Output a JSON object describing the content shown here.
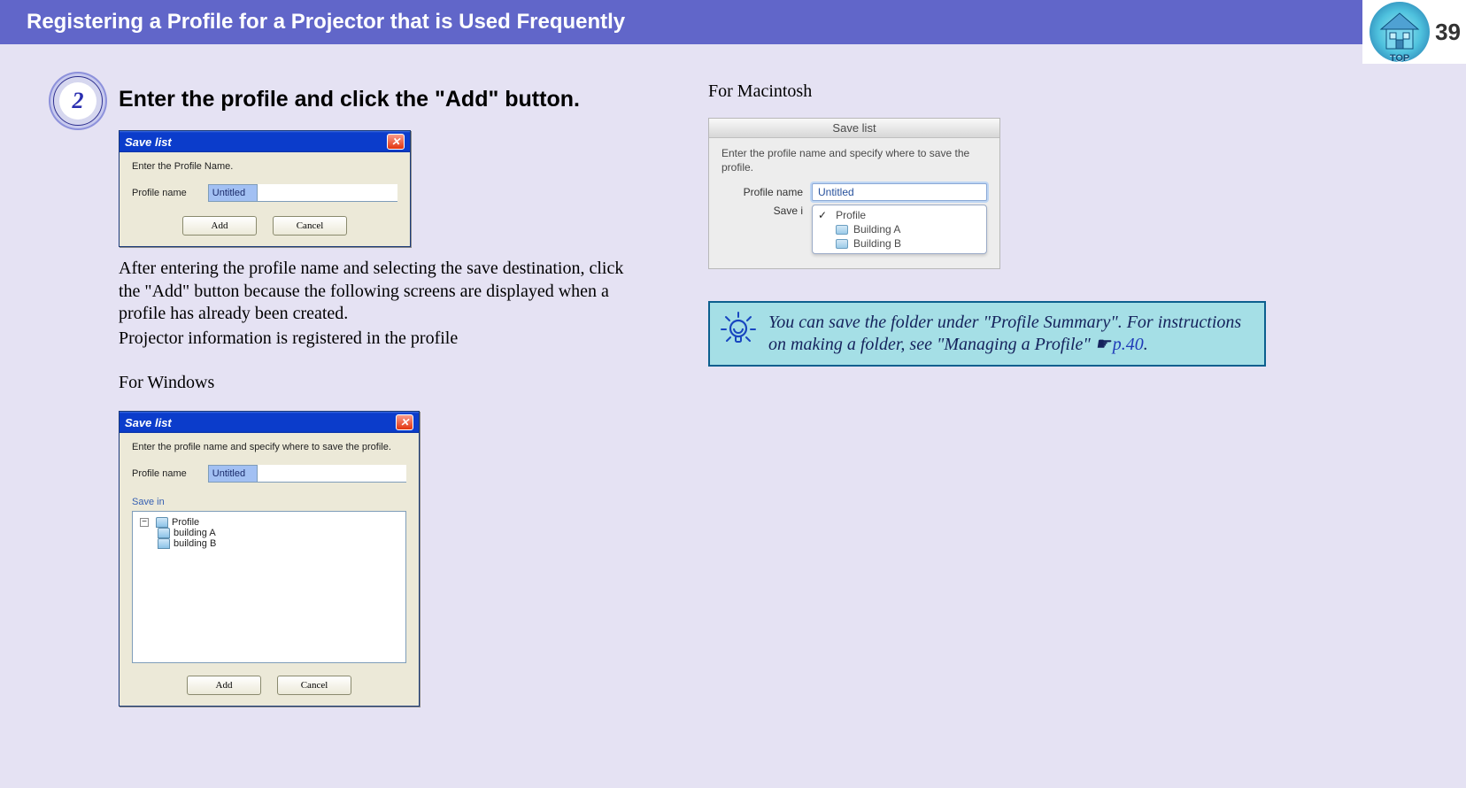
{
  "header": {
    "title": "Registering a Profile for a Projector that is Used Frequently",
    "pageNumber": "39",
    "topLabel": "TOP"
  },
  "step": {
    "number": "2",
    "title": "Enter the profile and click the \"Add\" button."
  },
  "dialog1": {
    "title": "Save list",
    "instruction": "Enter the Profile Name.",
    "profileLabel": "Profile name",
    "profileValue": "Untitled",
    "add": "Add",
    "cancel": "Cancel"
  },
  "paragraph1": "After entering the profile name and selecting the save destination, click the \"Add\" button because the following screens are displayed when a profile has already been created.",
  "paragraph2": "Projector information is registered in the profile",
  "forWindows": "For Windows",
  "dialog2": {
    "title": "Save list",
    "instruction": "Enter the profile name and specify where to save the profile.",
    "profileLabel": "Profile name",
    "profileValue": "Untitled",
    "saveIn": "Save in",
    "tree": {
      "root": "Profile",
      "a": "building A",
      "b": "building B"
    },
    "add": "Add",
    "cancel": "Cancel"
  },
  "forMac": "For Macintosh",
  "macDialog": {
    "title": "Save list",
    "instruction": "Enter the profile name and specify where to save the profile.",
    "profileLabel": "Profile name",
    "profileValue": "Untitled",
    "saveLabel": "Save i",
    "opt1": "Profile",
    "opt2": "Building A",
    "opt3": "Building B"
  },
  "tip": {
    "text": "You can save the folder under \"Profile Summary\". For instructions on making a folder, see \"Managing a Profile\" ",
    "pageRef": "p.40",
    "dot": "."
  }
}
